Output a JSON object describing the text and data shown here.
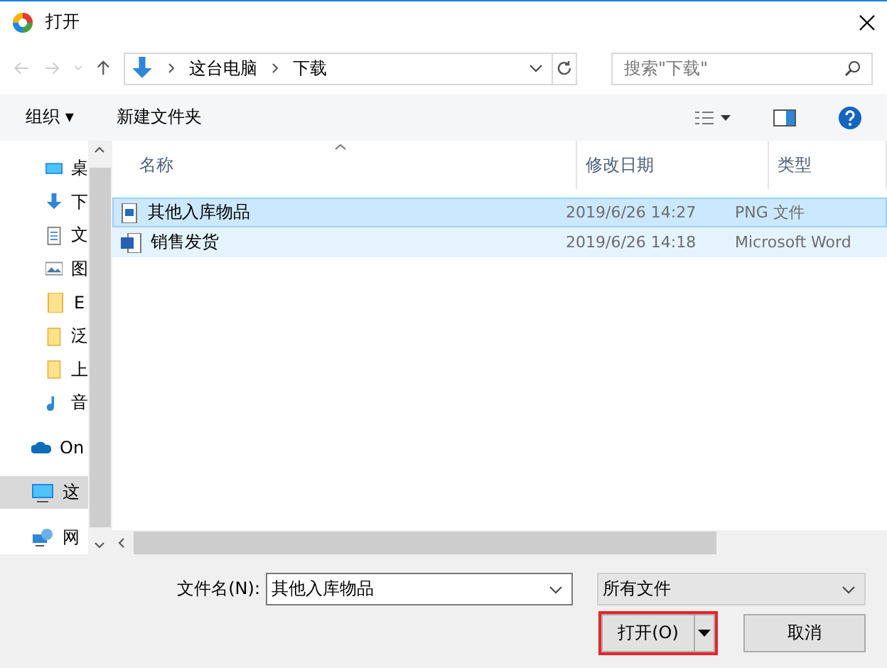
{
  "window": {
    "title": "打开"
  },
  "address": {
    "path": [
      "这台电脑",
      "下载"
    ]
  },
  "search": {
    "placeholder": "搜索\"下载\""
  },
  "toolbar": {
    "organize": "组织 ▾",
    "new_folder": "新建文件夹"
  },
  "sidebar": {
    "items": [
      {
        "label": "桌",
        "kind": "desktop",
        "selected": false
      },
      {
        "label": "下",
        "kind": "download",
        "selected": false
      },
      {
        "label": "文",
        "kind": "document",
        "selected": false
      },
      {
        "label": "图",
        "kind": "image",
        "selected": false
      },
      {
        "label": "E",
        "kind": "folder",
        "selected": false
      },
      {
        "label": "泛",
        "kind": "folder",
        "selected": false
      },
      {
        "label": "上",
        "kind": "folder",
        "selected": false
      },
      {
        "label": "音",
        "kind": "music",
        "selected": false
      },
      {
        "label": "On",
        "kind": "cloud",
        "selected": false
      },
      {
        "label": "这",
        "kind": "computer",
        "selected": true
      },
      {
        "label": "网",
        "kind": "network",
        "selected": false
      }
    ]
  },
  "table": {
    "columns": [
      "名称",
      "修改日期",
      "类型"
    ],
    "rows": [
      {
        "name": "其他入库物品",
        "date": "2019/6/26 14:27",
        "type": "PNG 文件",
        "kind": "image",
        "selected": true
      },
      {
        "name": "销售发货",
        "date": "2019/6/26 14:18",
        "type": "Microsoft Word",
        "kind": "word",
        "selected": false
      }
    ]
  },
  "filename": {
    "label": "文件名(N):",
    "value": "其他入库物品"
  },
  "filter": {
    "value": "所有文件"
  },
  "buttons": [
    {
      "label": "打开(O)",
      "kind": "split",
      "highlighted": true
    },
    {
      "label": "取消",
      "kind": "plain",
      "highlighted": false
    }
  ]
}
